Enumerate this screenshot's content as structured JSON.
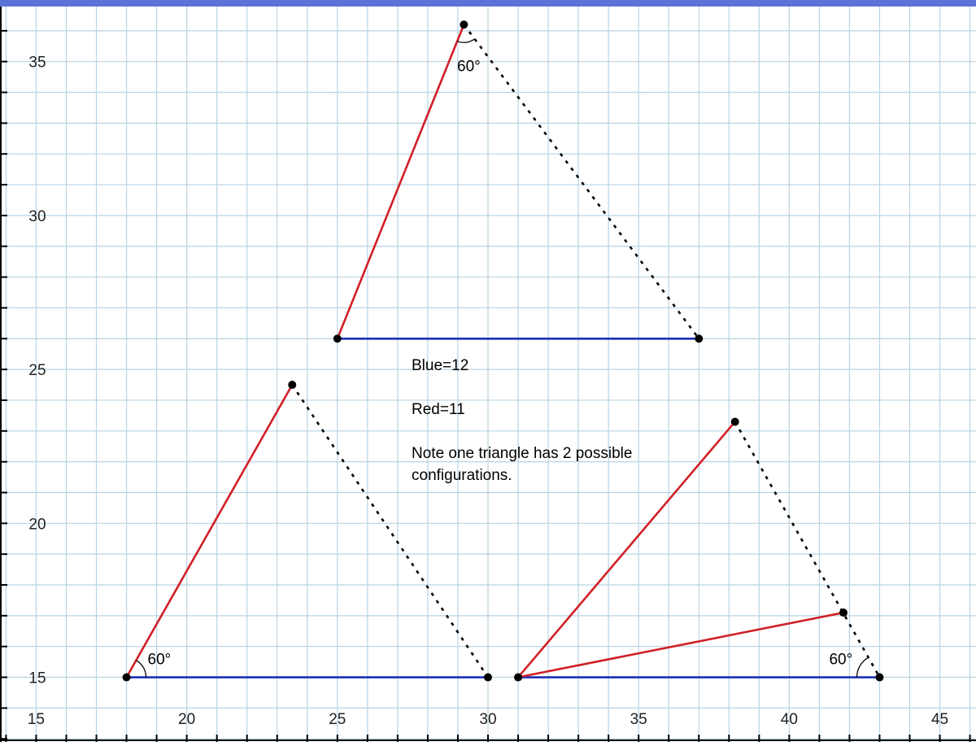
{
  "colors": {
    "top_bar": "#5b73d9",
    "grid": "#b9d3e3",
    "axis": "#000000",
    "blue_side": "#1a2fb5",
    "red_side": "#d11f26",
    "dotted_side": "#000000",
    "point": "#000000"
  },
  "axes": {
    "x_ticks": [
      "15",
      "20",
      "25",
      "30",
      "35",
      "40",
      "45"
    ],
    "y_ticks": [
      "15",
      "20",
      "25",
      "30",
      "35"
    ],
    "xlim": [
      13.8,
      46.2
    ],
    "ylim": [
      12.9,
      37.0
    ],
    "grid": true,
    "grid_step": 1
  },
  "triangles": [
    {
      "name": "top",
      "blue": [
        [
          25,
          26
        ],
        [
          37,
          26
        ]
      ],
      "red": [
        [
          25,
          26
        ],
        [
          29.2,
          36.2
        ]
      ],
      "dotted": [
        [
          29.2,
          36.2
        ],
        [
          37,
          26
        ]
      ],
      "points": [
        [
          25,
          26
        ],
        [
          37,
          26
        ],
        [
          29.2,
          36.2
        ]
      ],
      "angle": {
        "vertex": [
          29.2,
          36.2
        ],
        "label": "60°"
      }
    },
    {
      "name": "bottom-left",
      "blue": [
        [
          18,
          15
        ],
        [
          30,
          15
        ]
      ],
      "red": [
        [
          18,
          15
        ],
        [
          23.5,
          24.5
        ]
      ],
      "dotted": [
        [
          23.5,
          24.5
        ],
        [
          30,
          15
        ]
      ],
      "points": [
        [
          18,
          15
        ],
        [
          30,
          15
        ],
        [
          23.5,
          24.5
        ]
      ],
      "angle": {
        "vertex": [
          18,
          15
        ],
        "label": "60°"
      }
    },
    {
      "name": "bottom-right",
      "blue": [
        [
          31,
          15
        ],
        [
          43,
          15
        ]
      ],
      "red": [
        [
          31,
          15
        ],
        [
          38.2,
          23.3
        ]
      ],
      "red2": [
        [
          31,
          15
        ],
        [
          41.8,
          17.1
        ]
      ],
      "dotted": [
        [
          38.2,
          23.3
        ],
        [
          43,
          15
        ]
      ],
      "points": [
        [
          31,
          15
        ],
        [
          43,
          15
        ],
        [
          38.2,
          23.3
        ],
        [
          41.8,
          17.1
        ]
      ],
      "angle": {
        "vertex": [
          43,
          15
        ],
        "label": "60°"
      }
    }
  ],
  "notes": {
    "blue": "Blue=12",
    "red": "Red=11",
    "note_line1": "Note one triangle has 2 possible",
    "note_line2": "configurations."
  }
}
